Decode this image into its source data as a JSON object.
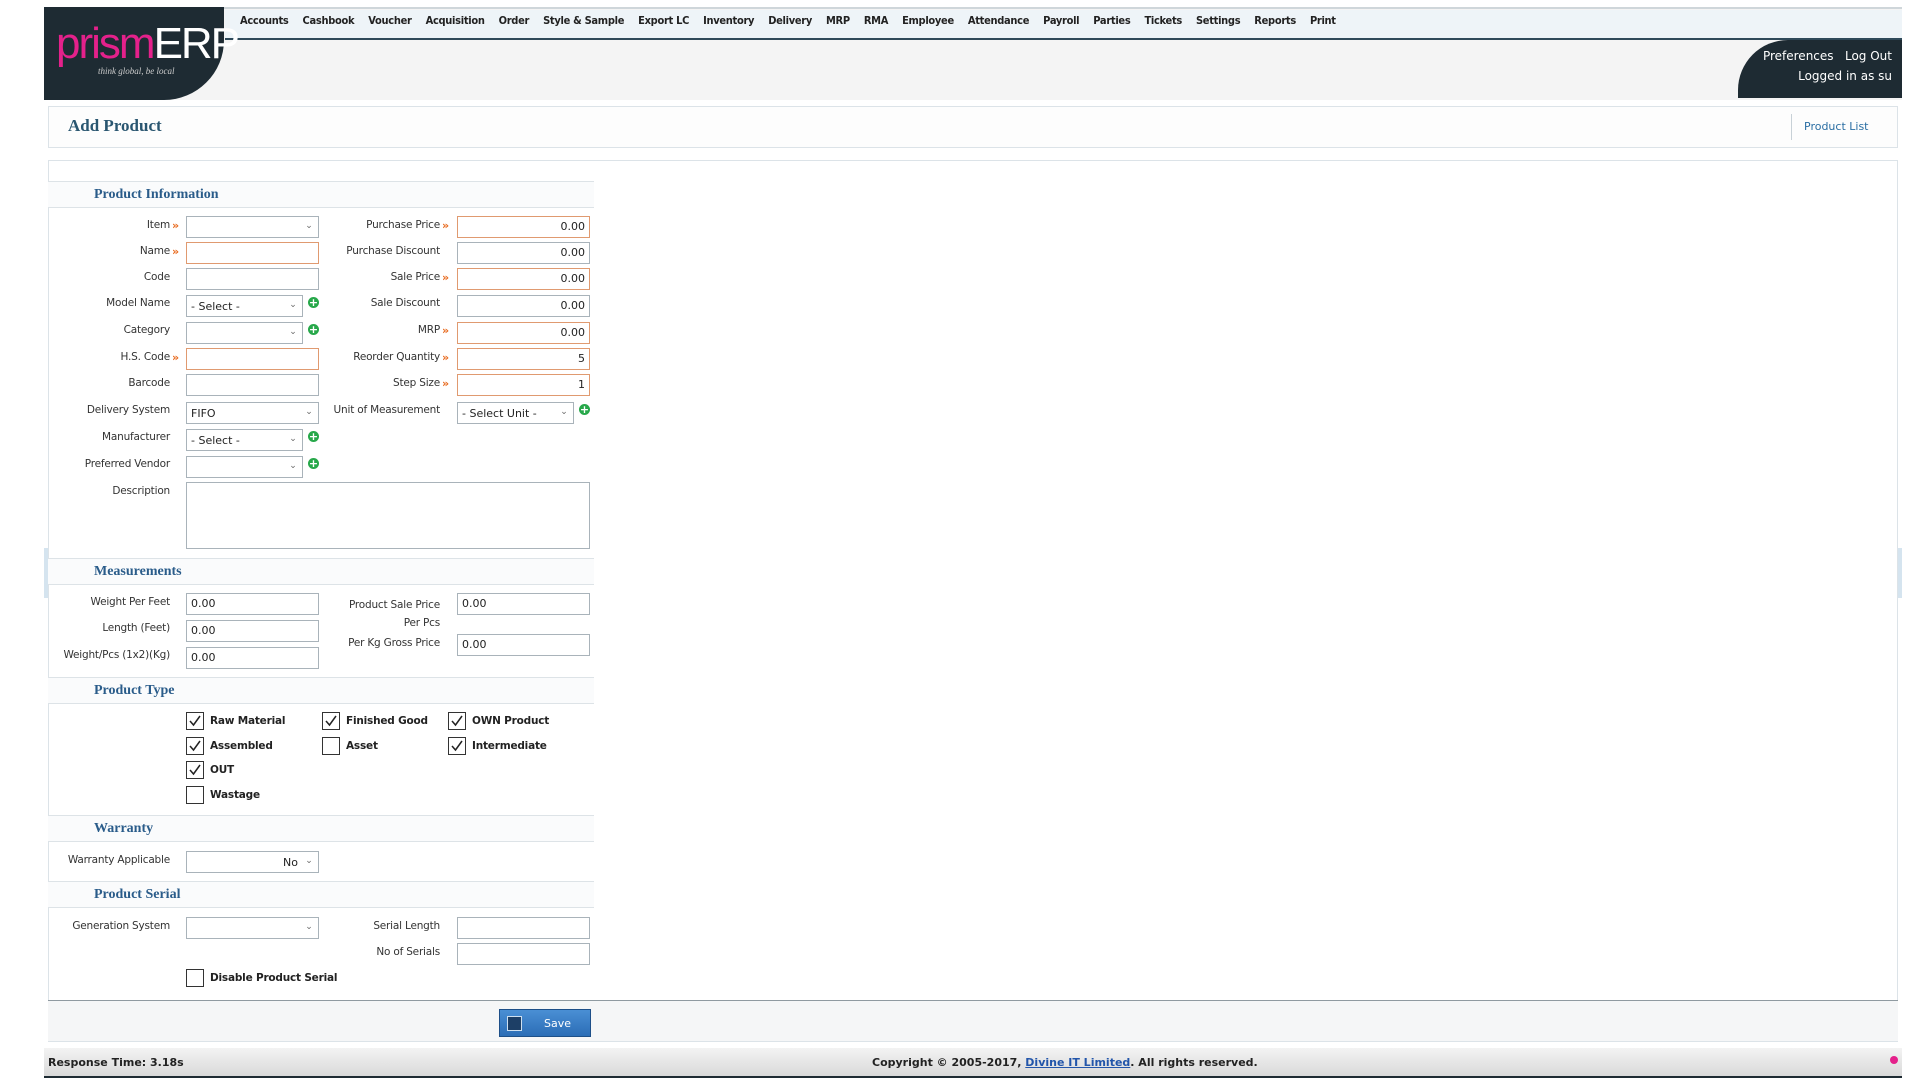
{
  "app": {
    "logo_main_a": "prism",
    "logo_main_b": "ERP",
    "logo_tagline": "think global, be local",
    "menu": [
      "Accounts",
      "Cashbook",
      "Voucher",
      "Acquisition",
      "Order",
      "Style & Sample",
      "Export LC",
      "Inventory",
      "Delivery",
      "MRP",
      "RMA",
      "Employee",
      "Attendance",
      "Payroll",
      "Parties",
      "Tickets",
      "Settings",
      "Reports",
      "Print"
    ],
    "preferences": "Preferences",
    "logout": "Log Out",
    "logged_in": "Logged in as su"
  },
  "page": {
    "title": "Add Product",
    "product_list_link": "Product List"
  },
  "sections": {
    "product_info": "Product Information",
    "measurements": "Measurements",
    "product_type": "Product Type",
    "warranty": "Warranty",
    "product_serial": "Product Serial"
  },
  "form": {
    "left": {
      "item": {
        "label": "Item",
        "value": ""
      },
      "name": {
        "label": "Name",
        "value": ""
      },
      "code": {
        "label": "Code",
        "value": ""
      },
      "model_name": {
        "label": "Model Name",
        "value": "- Select -"
      },
      "category": {
        "label": "Category",
        "value": ""
      },
      "hs_code": {
        "label": "H.S. Code",
        "value": ""
      },
      "barcode": {
        "label": "Barcode",
        "value": ""
      },
      "delivery_system": {
        "label": "Delivery System",
        "value": "FIFO"
      },
      "manufacturer": {
        "label": "Manufacturer",
        "value": "- Select -"
      },
      "preferred_vendor": {
        "label": "Preferred Vendor",
        "value": ""
      },
      "description": {
        "label": "Description",
        "value": ""
      }
    },
    "right": {
      "purchase_price": {
        "label": "Purchase Price",
        "value": "0.00"
      },
      "purchase_discount": {
        "label": "Purchase Discount",
        "value": "0.00"
      },
      "sale_price": {
        "label": "Sale Price",
        "value": "0.00"
      },
      "sale_discount": {
        "label": "Sale Discount",
        "value": "0.00"
      },
      "mrp": {
        "label": "MRP",
        "value": "0.00"
      },
      "reorder_quantity": {
        "label": "Reorder Quantity",
        "value": "5"
      },
      "step_size": {
        "label": "Step Size",
        "value": "1"
      },
      "unit_of_measurement": {
        "label": "Unit of Measurement",
        "value": "- Select Unit -"
      }
    },
    "measurements": {
      "weight_per_feet": {
        "label": "Weight Per Feet",
        "value": "0.00"
      },
      "length_feet": {
        "label": "Length (Feet)",
        "value": "0.00"
      },
      "weight_pcs": {
        "label": "Weight/Pcs (1x2)(Kg)",
        "value": "0.00"
      },
      "sale_price_per_pcs": {
        "label": "Product Sale Price Per Pcs",
        "value": "0.00"
      },
      "per_kg_gross_price": {
        "label": "Per Kg Gross Price",
        "value": "0.00"
      }
    },
    "product_type": {
      "raw_material": {
        "label": "Raw Material",
        "checked": true
      },
      "finished_good": {
        "label": "Finished Good",
        "checked": true
      },
      "own_product": {
        "label": "OWN Product",
        "checked": true
      },
      "assembled": {
        "label": "Assembled",
        "checked": true
      },
      "asset": {
        "label": "Asset",
        "checked": false
      },
      "intermediate": {
        "label": "Intermediate",
        "checked": true
      },
      "out": {
        "label": "OUT",
        "checked": true
      },
      "wastage": {
        "label": "Wastage",
        "checked": false
      }
    },
    "warranty": {
      "warranty_applicable": {
        "label": "Warranty Applicable",
        "value": "No"
      }
    },
    "serial": {
      "generation_system": {
        "label": "Generation System",
        "value": ""
      },
      "serial_length": {
        "label": "Serial Length",
        "value": ""
      },
      "no_of_serials": {
        "label": "No of Serials",
        "value": ""
      },
      "disable_serial": {
        "label": "Disable Product Serial",
        "checked": false
      }
    },
    "save_label": "Save"
  },
  "footer": {
    "response_time": "Response Time: 3.18s",
    "copyright_pre": "Copyright © 2005-2017, ",
    "company": "Divine IT Limited",
    "copyright_post": ". All rights reserved."
  }
}
